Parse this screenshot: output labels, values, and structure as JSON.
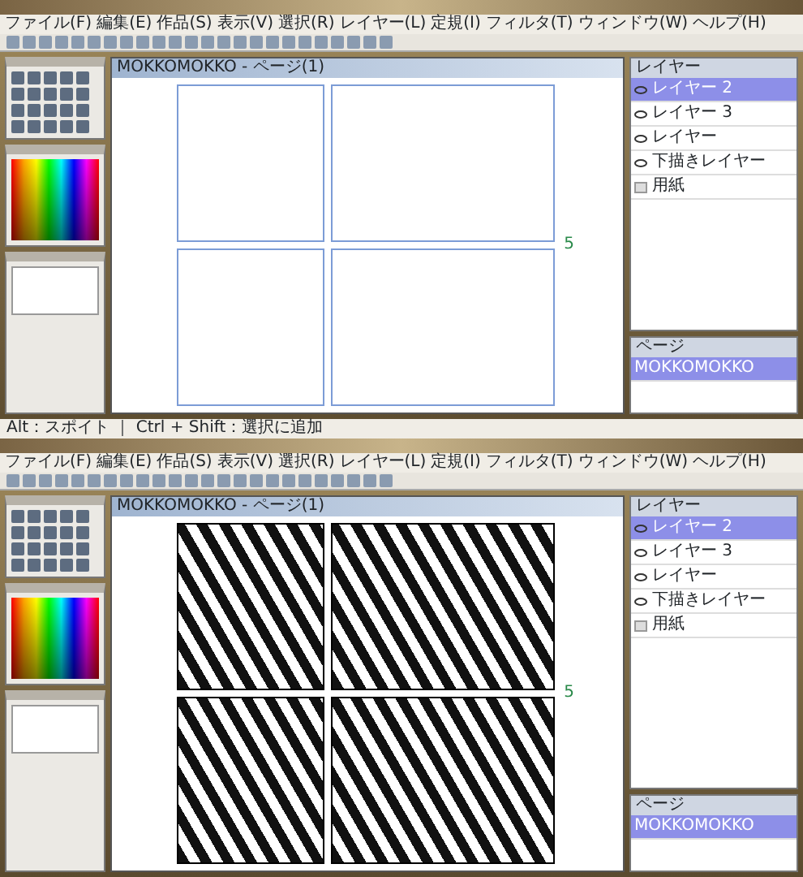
{
  "screens": [
    {
      "kind": "sketch",
      "menu": [
        "ファイル(F)",
        "編集(E)",
        "作品(S)",
        "表示(V)",
        "選択(R)",
        "レイヤー(L)",
        "定規(I)",
        "フィルタ(T)",
        "ウィンドウ(W)",
        "ヘルプ(H)"
      ],
      "document_title": "MOKKOMOKKO - ページ(1)",
      "page_number": "5",
      "layers_title": "レイヤー",
      "layers": [
        {
          "name": "レイヤー 2",
          "visible": true,
          "selected": true
        },
        {
          "name": "レイヤー 3",
          "visible": true,
          "selected": false
        },
        {
          "name": "レイヤー",
          "visible": true,
          "selected": false
        },
        {
          "name": "下描きレイヤー",
          "visible": true,
          "selected": false
        },
        {
          "name": "用紙",
          "visible": false,
          "selected": false
        }
      ],
      "pages_title": "ページ",
      "pages": [
        {
          "name": "MOKKOMOKKO",
          "selected": true
        }
      ],
      "status_bar": "Alt：スポイト ｜ Ctrl + Shift：選択に追加"
    },
    {
      "kind": "inked",
      "menu": [
        "ファイル(F)",
        "編集(E)",
        "作品(S)",
        "表示(V)",
        "選択(R)",
        "レイヤー(L)",
        "定規(I)",
        "フィルタ(T)",
        "ウィンドウ(W)",
        "ヘルプ(H)"
      ],
      "document_title": "MOKKOMOKKO - ページ(1)",
      "page_number": "5",
      "layers_title": "レイヤー",
      "layers": [
        {
          "name": "レイヤー 2",
          "visible": true,
          "selected": true
        },
        {
          "name": "レイヤー 3",
          "visible": true,
          "selected": false
        },
        {
          "name": "レイヤー",
          "visible": true,
          "selected": false
        },
        {
          "name": "下描きレイヤー",
          "visible": true,
          "selected": false
        },
        {
          "name": "用紙",
          "visible": false,
          "selected": false
        }
      ],
      "pages_title": "ページ",
      "pages": [
        {
          "name": "MOKKOMOKKO",
          "selected": true
        }
      ]
    }
  ]
}
